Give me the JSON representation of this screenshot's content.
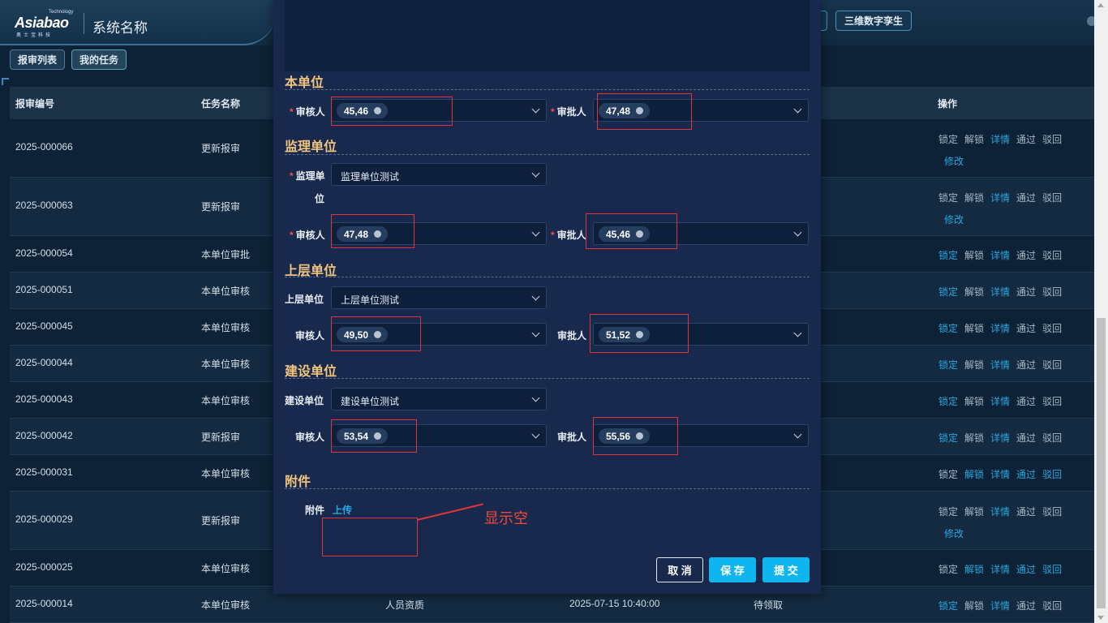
{
  "header": {
    "logo_text": "Asiabao",
    "logo_sub": "Technology",
    "logo_cn": "奥士宝科技",
    "system_title": "系统名称",
    "twin_button": "三维数字孪生"
  },
  "tabs": [
    "报审列表",
    "我的任务"
  ],
  "table": {
    "headers": [
      "报审编号",
      "任务名称",
      "操作"
    ],
    "rows": [
      {
        "id": "2025-000066",
        "task": "更新报审"
      },
      {
        "id": "2025-000063",
        "task": "更新报审"
      },
      {
        "id": "2025-000054",
        "task": "本单位审批"
      },
      {
        "id": "2025-000051",
        "task": "本单位审核"
      },
      {
        "id": "2025-000045",
        "task": "本单位审核"
      },
      {
        "id": "2025-000044",
        "task": "本单位审核"
      },
      {
        "id": "2025-000043",
        "task": "本单位审核"
      },
      {
        "id": "2025-000042",
        "task": "更新报审"
      },
      {
        "id": "2025-000031",
        "task": "本单位审核"
      },
      {
        "id": "2025-000029",
        "task": "更新报审"
      },
      {
        "id": "2025-000025",
        "task": "本单位审核"
      },
      {
        "id": "2025-000014",
        "task": "本单位审核",
        "category": "人员资质",
        "time": "2025-07-15 10:40:00",
        "status": "待领取"
      }
    ],
    "ops": {
      "lock": "锁定",
      "unlock": "解锁",
      "detail": "详情",
      "pass": "通过",
      "reject": "驳回",
      "edit": "修改"
    }
  },
  "modal": {
    "sections": {
      "own_unit": "本单位",
      "supervision_unit": "监理单位",
      "upper_unit": "上层单位",
      "construction_unit": "建设单位",
      "attachment": "附件"
    },
    "labels": {
      "reviewer": "审核人",
      "approver": "审批人",
      "supervision_unit_l1": "监理单",
      "supervision_unit_l2": "位",
      "upper_unit": "上层单位",
      "construction_unit": "建设单位",
      "attachment": "附件"
    },
    "values": {
      "own_reviewer": "45,46",
      "own_approver": "47,48",
      "supervision_unit": "监理单位测试",
      "sup_reviewer": "47,48",
      "sup_approver": "45,46",
      "upper_unit": "上层单位测试",
      "upper_reviewer": "49,50",
      "upper_approver": "51,52",
      "construction_unit": "建设单位测试",
      "con_reviewer": "53,54",
      "con_approver": "55,56"
    },
    "upload": "上传",
    "buttons": {
      "cancel": "取 消",
      "save": "保 存",
      "submit": "提 交"
    }
  },
  "annotation": "显示空"
}
